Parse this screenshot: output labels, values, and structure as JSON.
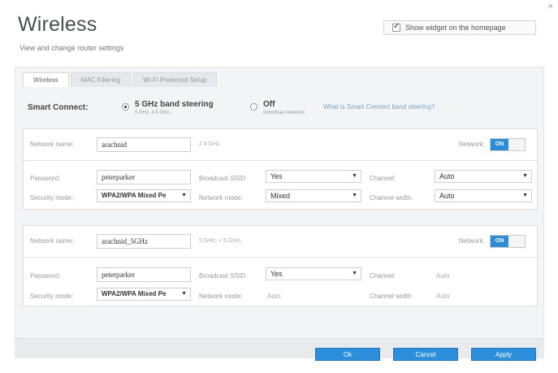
{
  "window": {
    "close_icon": "×",
    "title": "Wireless",
    "subtitle": "View and change router settings"
  },
  "widget": {
    "checked": true,
    "label": "Show widget on the homepage"
  },
  "tabs": [
    {
      "label": "Wireless",
      "active": true
    },
    {
      "label": "MAC Filtering",
      "active": false
    },
    {
      "label": "Wi-Fi Protected Setup",
      "active": false
    }
  ],
  "smart_connect": {
    "label": "Smart Connect:",
    "option_on": {
      "label": "5 GHz band steering",
      "sublabel": "5 GHz, 4.5 GHz₂",
      "selected": true
    },
    "option_off": {
      "label": "Off",
      "sublabel": "Individual networks",
      "selected": false
    },
    "help_link": "What is Smart Connect band steering?"
  },
  "network1": {
    "name_label": "Network name:",
    "name_value": "arachnid",
    "band": "2.4 GHz",
    "network_label": "Network:",
    "toggle": "ON",
    "password_label": "Password:",
    "password_value": "peterparker",
    "security_label": "Security mode:",
    "security_value": "WPA2/WPA Mixed Pe",
    "broadcast_label": "Broadcast SSID:",
    "broadcast_value": "Yes",
    "mode_label": "Network mode:",
    "mode_value": "Mixed",
    "channel_label": "Channel:",
    "channel_value": "Auto",
    "width_label": "Channel width:",
    "width_value": "Auto"
  },
  "network2": {
    "name_label": "Network name:",
    "name_value": "arachnid_5GHz",
    "band": "5 GHz₁ + 5 GHz₂",
    "network_label": "Network:",
    "toggle": "ON",
    "password_label": "Password:",
    "password_value": "peterparker",
    "security_label": "Security mode:",
    "security_value": "WPA2/WPA Mixed Pe",
    "broadcast_label": "Broadcast SSID:",
    "broadcast_value": "Yes",
    "mode_label": "Network mode:",
    "mode_value": "Auto",
    "channel_label": "Channel:",
    "channel_value": "Auto",
    "width_label": "Channel width:",
    "width_value": "Auto"
  },
  "buttons": {
    "ok": "Ok",
    "cancel": "Cancel",
    "apply": "Apply"
  },
  "colors": {
    "accent": "#2d8fdb",
    "link": "#7fa3c2"
  }
}
